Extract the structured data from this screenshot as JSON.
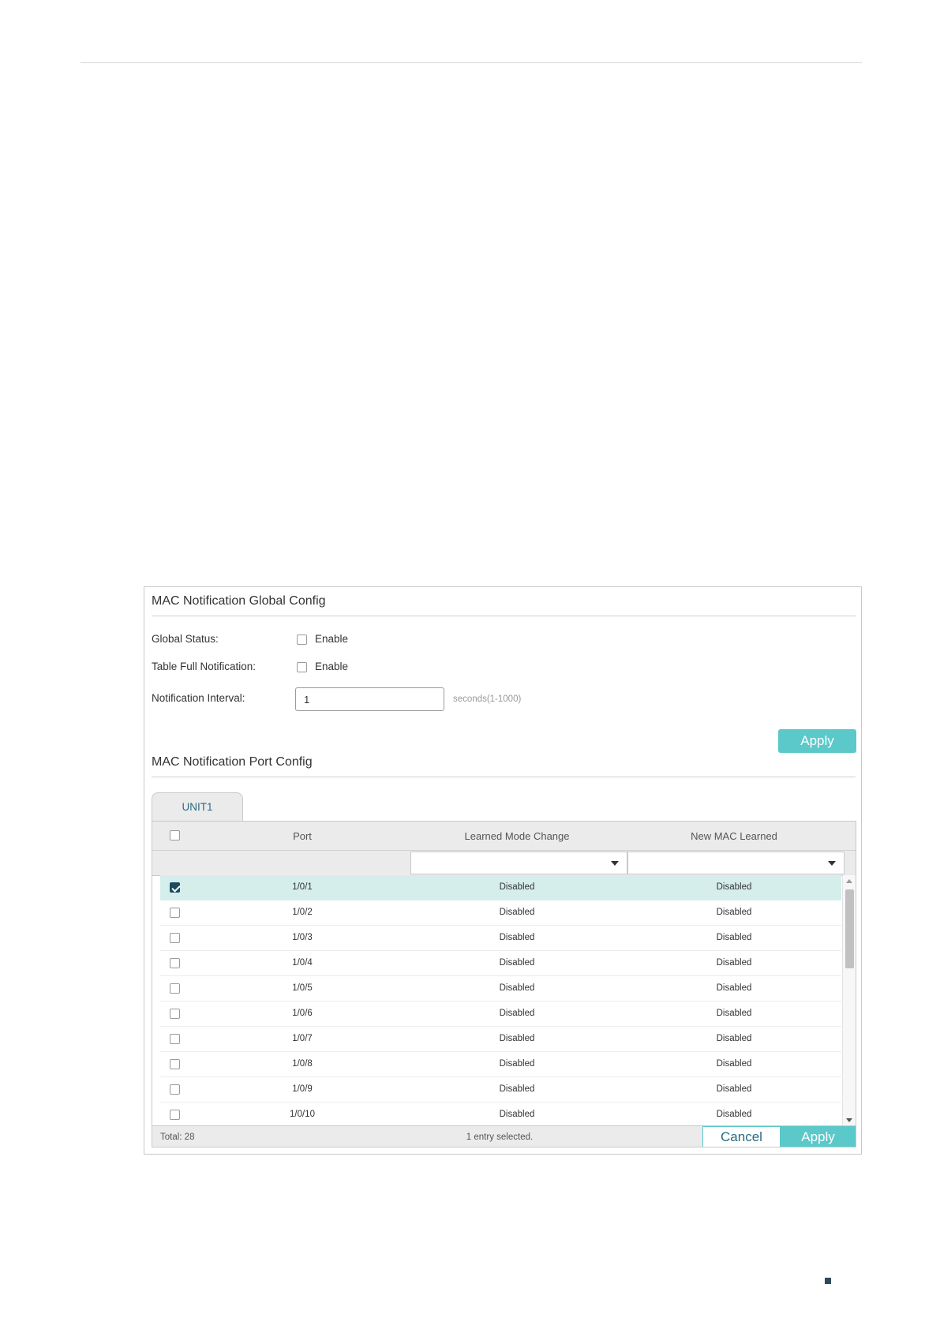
{
  "global_config": {
    "title": "MAC Notification Global Config",
    "global_status_label": "Global Status:",
    "global_status_option": "Enable",
    "table_full_label": "Table Full Notification:",
    "table_full_option": "Enable",
    "interval_label": "Notification Interval:",
    "interval_value": "1",
    "interval_hint": "seconds(1-1000)",
    "apply_label": "Apply"
  },
  "port_config": {
    "title": "MAC Notification Port Config",
    "tab_label": "UNIT1",
    "columns": [
      "Port",
      "Learned Mode Change",
      "New MAC Learned"
    ],
    "rows": [
      {
        "port": "1/0/1",
        "learned_mode_change": "Disabled",
        "new_mac_learned": "Disabled",
        "checked": true
      },
      {
        "port": "1/0/2",
        "learned_mode_change": "Disabled",
        "new_mac_learned": "Disabled",
        "checked": false
      },
      {
        "port": "1/0/3",
        "learned_mode_change": "Disabled",
        "new_mac_learned": "Disabled",
        "checked": false
      },
      {
        "port": "1/0/4",
        "learned_mode_change": "Disabled",
        "new_mac_learned": "Disabled",
        "checked": false
      },
      {
        "port": "1/0/5",
        "learned_mode_change": "Disabled",
        "new_mac_learned": "Disabled",
        "checked": false
      },
      {
        "port": "1/0/6",
        "learned_mode_change": "Disabled",
        "new_mac_learned": "Disabled",
        "checked": false
      },
      {
        "port": "1/0/7",
        "learned_mode_change": "Disabled",
        "new_mac_learned": "Disabled",
        "checked": false
      },
      {
        "port": "1/0/8",
        "learned_mode_change": "Disabled",
        "new_mac_learned": "Disabled",
        "checked": false
      },
      {
        "port": "1/0/9",
        "learned_mode_change": "Disabled",
        "new_mac_learned": "Disabled",
        "checked": false
      },
      {
        "port": "1/0/10",
        "learned_mode_change": "Disabled",
        "new_mac_learned": "Disabled",
        "checked": false
      }
    ],
    "total_label": "Total: 28",
    "selection_status": "1 entry selected.",
    "cancel_label": "Cancel",
    "apply_label": "Apply"
  },
  "colors": {
    "accent": "#5bc8c9",
    "selected_row": "#d5eeec",
    "checkbox_checked": "#1b4b5e",
    "header_bg": "#ebebeb"
  }
}
